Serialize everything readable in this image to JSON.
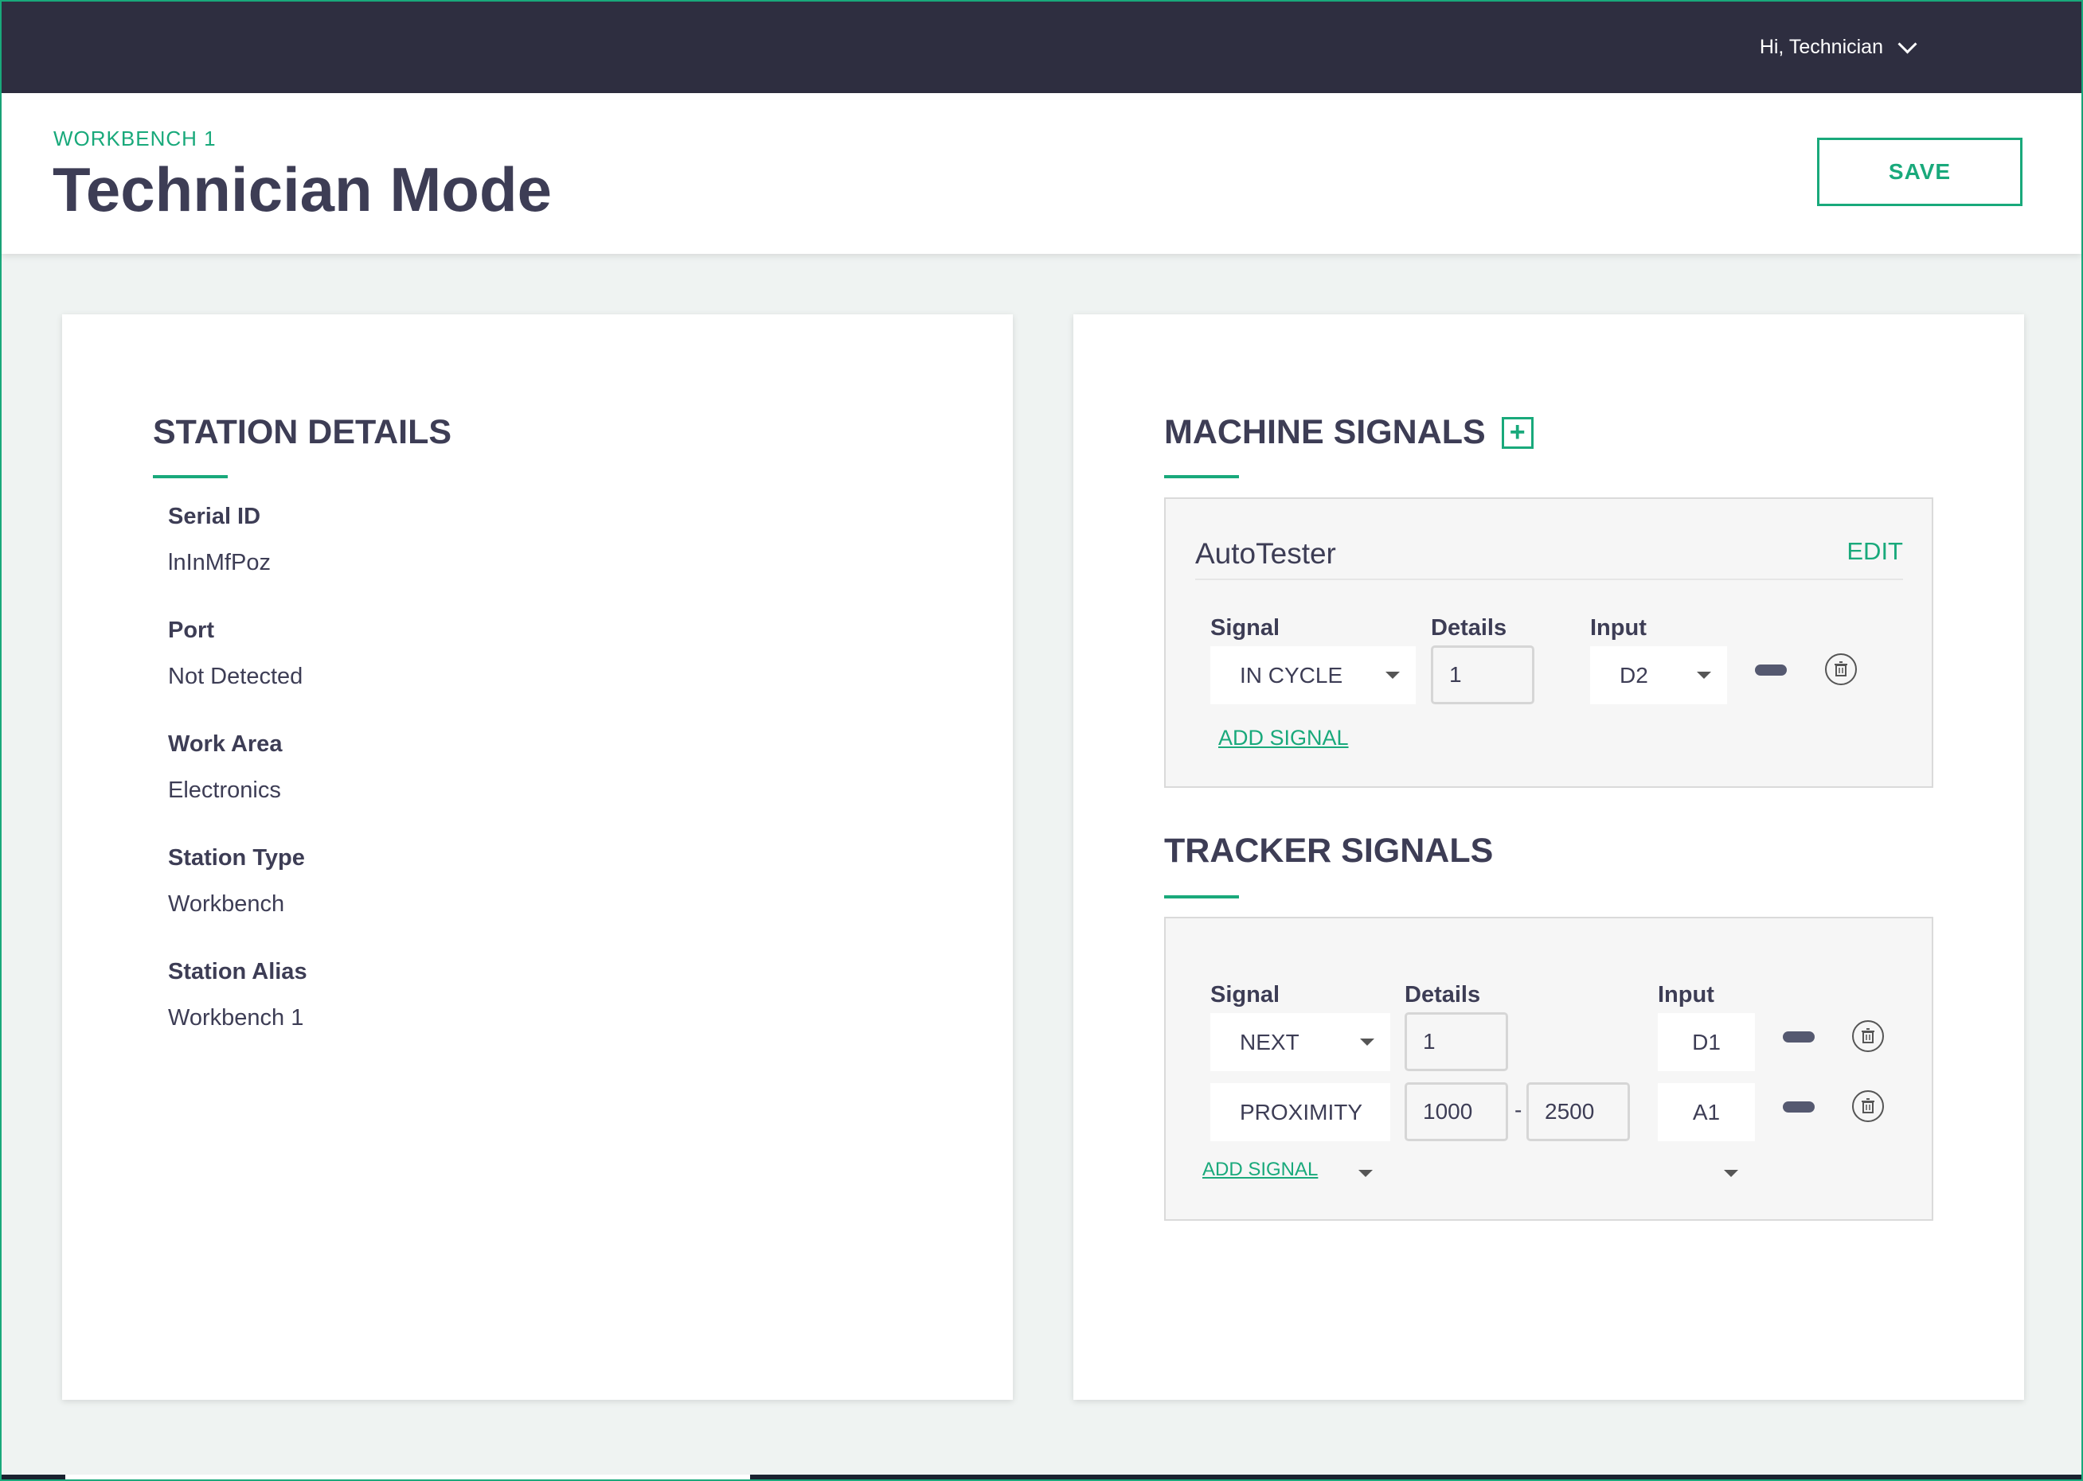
{
  "topbar": {
    "greeting": "Hi, Technician",
    "menu_icon": "chevron-down-icon"
  },
  "header": {
    "breadcrumb": "WORKBENCH 1",
    "title": "Technician Mode",
    "save_label": "SAVE"
  },
  "station_details": {
    "title": "STATION DETAILS",
    "fields": [
      {
        "label": "Serial ID",
        "value": "lnInMfPoz"
      },
      {
        "label": "Port",
        "value": "Not Detected"
      },
      {
        "label": "Work Area",
        "value": "Electronics"
      },
      {
        "label": "Station Type",
        "value": "Workbench"
      },
      {
        "label": "Station Alias",
        "value": "Workbench 1"
      }
    ]
  },
  "machine_signals": {
    "title": "MACHINE SIGNALS",
    "add_icon": "plus-square-icon",
    "machine_name": "AutoTester",
    "edit_label": "EDIT",
    "col_signal": "Signal",
    "col_details": "Details",
    "col_input": "Input",
    "rows": [
      {
        "signal": "IN CYCLE",
        "details": "1",
        "input": "D2"
      }
    ],
    "add_signal_label": "ADD SIGNAL"
  },
  "tracker_signals": {
    "title": "TRACKER SIGNALS",
    "col_signal": "Signal",
    "col_details": "Details",
    "col_input": "Input",
    "rows": [
      {
        "signal": "NEXT",
        "details": "1",
        "input": "D1"
      },
      {
        "signal": "PROXIMITY",
        "details_min": "1000",
        "separator": "-",
        "details_max": "2500",
        "input": "A1"
      }
    ],
    "add_signal_label": "ADD SIGNAL"
  },
  "colors": {
    "accent": "#19a97b",
    "topbar": "#2e2e40",
    "text": "#3d3d55",
    "background": "#eff3f2"
  }
}
